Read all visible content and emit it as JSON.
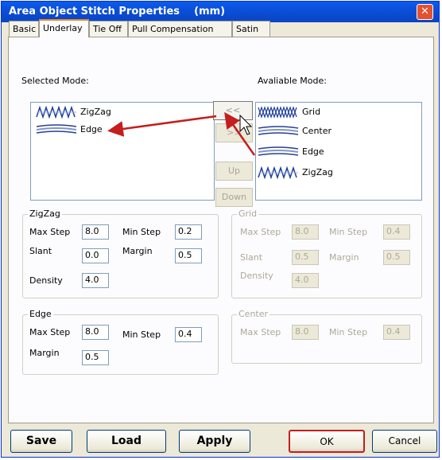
{
  "window": {
    "title": "Area Object Stitch Properties    (mm)",
    "close": "✕"
  },
  "tabs": [
    "Basic",
    "Underlay",
    "Tie Off",
    "Pull Compensation",
    "Satin"
  ],
  "selected_mode": {
    "label": "Selected Mode:",
    "items": [
      "ZigZag",
      "Edge"
    ]
  },
  "available_mode": {
    "label": "Avaliable Mode:",
    "items": [
      "Grid",
      "Center",
      "Edge",
      "ZigZag"
    ]
  },
  "move_buttons": {
    "add": "<<",
    "remove": ">>",
    "up": "Up",
    "down": "Down"
  },
  "zigzag": {
    "title": "ZigZag",
    "max_step_label": "Max Step",
    "max_step": "8.0",
    "min_step_label": "Min Step",
    "min_step": "0.2",
    "slant_label": "Slant",
    "slant": "0.0",
    "margin_label": "Margin",
    "margin": "0.5",
    "density_label": "Density",
    "density": "4.0"
  },
  "edge": {
    "title": "Edge",
    "max_step_label": "Max Step",
    "max_step": "8.0",
    "min_step_label": "Min Step",
    "min_step": "0.4",
    "margin_label": "Margin",
    "margin": "0.5"
  },
  "grid": {
    "title": "Grid",
    "max_step_label": "Max Step",
    "max_step": "8.0",
    "min_step_label": "Min Step",
    "min_step": "0.4",
    "slant_label": "Slant",
    "slant": "0.5",
    "margin_label": "Margin",
    "margin": "0.5",
    "density_label": "Density",
    "density": "4.0"
  },
  "center": {
    "title": "Center",
    "max_step_label": "Max Step",
    "max_step": "8.0",
    "min_step_label": "Min Step",
    "min_step": "0.4"
  },
  "footer": {
    "save": "Save",
    "load": "Load",
    "apply": "Apply",
    "ok": "OK",
    "cancel": "Cancel"
  },
  "colors": {
    "title_bar": "#0b4fd8",
    "annotation_red": "#c41e1e",
    "zigzag_icon": "#1e3f9a",
    "edge_icon": "#7f97c8",
    "ok_highlight": "#c41e1e"
  }
}
